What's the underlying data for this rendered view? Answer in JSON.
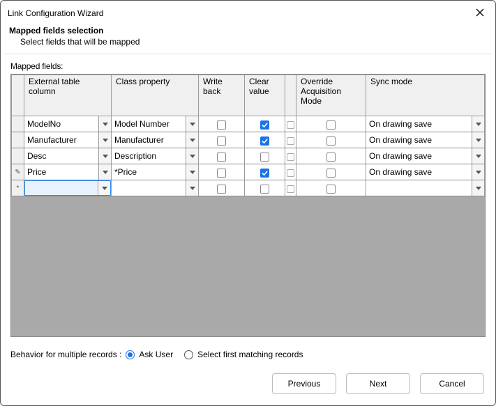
{
  "window": {
    "title": "Link Configuration Wizard"
  },
  "header": {
    "title": "Mapped fields selection",
    "subtitle": "Select fields that will be mapped"
  },
  "grid": {
    "label": "Mapped fields:",
    "columns": {
      "external": "External table column",
      "classprop": "Class property",
      "writeback": "Write back",
      "clearvalue": "Clear value",
      "override": "Override Acquisition Mode",
      "syncmode": "Sync mode"
    },
    "rows": [
      {
        "handle": "",
        "external": "ModelNo",
        "classprop": "Model Number",
        "writeback": false,
        "clearvalue": true,
        "override": false,
        "syncmode": "On drawing save"
      },
      {
        "handle": "",
        "external": "Manufacturer",
        "classprop": "Manufacturer",
        "writeback": false,
        "clearvalue": true,
        "override": false,
        "syncmode": "On drawing save"
      },
      {
        "handle": "",
        "external": "Desc",
        "classprop": "Description",
        "writeback": false,
        "clearvalue": false,
        "override": false,
        "syncmode": "On drawing save"
      },
      {
        "handle": "✎",
        "external": "Price",
        "classprop": "*Price",
        "writeback": false,
        "clearvalue": true,
        "override": false,
        "syncmode": "On drawing save"
      },
      {
        "handle": "*",
        "external": "",
        "classprop": "",
        "writeback": false,
        "clearvalue": false,
        "override": false,
        "syncmode": "",
        "editing": true
      }
    ]
  },
  "behavior": {
    "label": "Behavior for multiple records :",
    "options": {
      "ask": "Ask User",
      "first": "Select first matching records"
    },
    "selected": "ask"
  },
  "footer": {
    "previous": "Previous",
    "next": "Next",
    "cancel": "Cancel"
  }
}
